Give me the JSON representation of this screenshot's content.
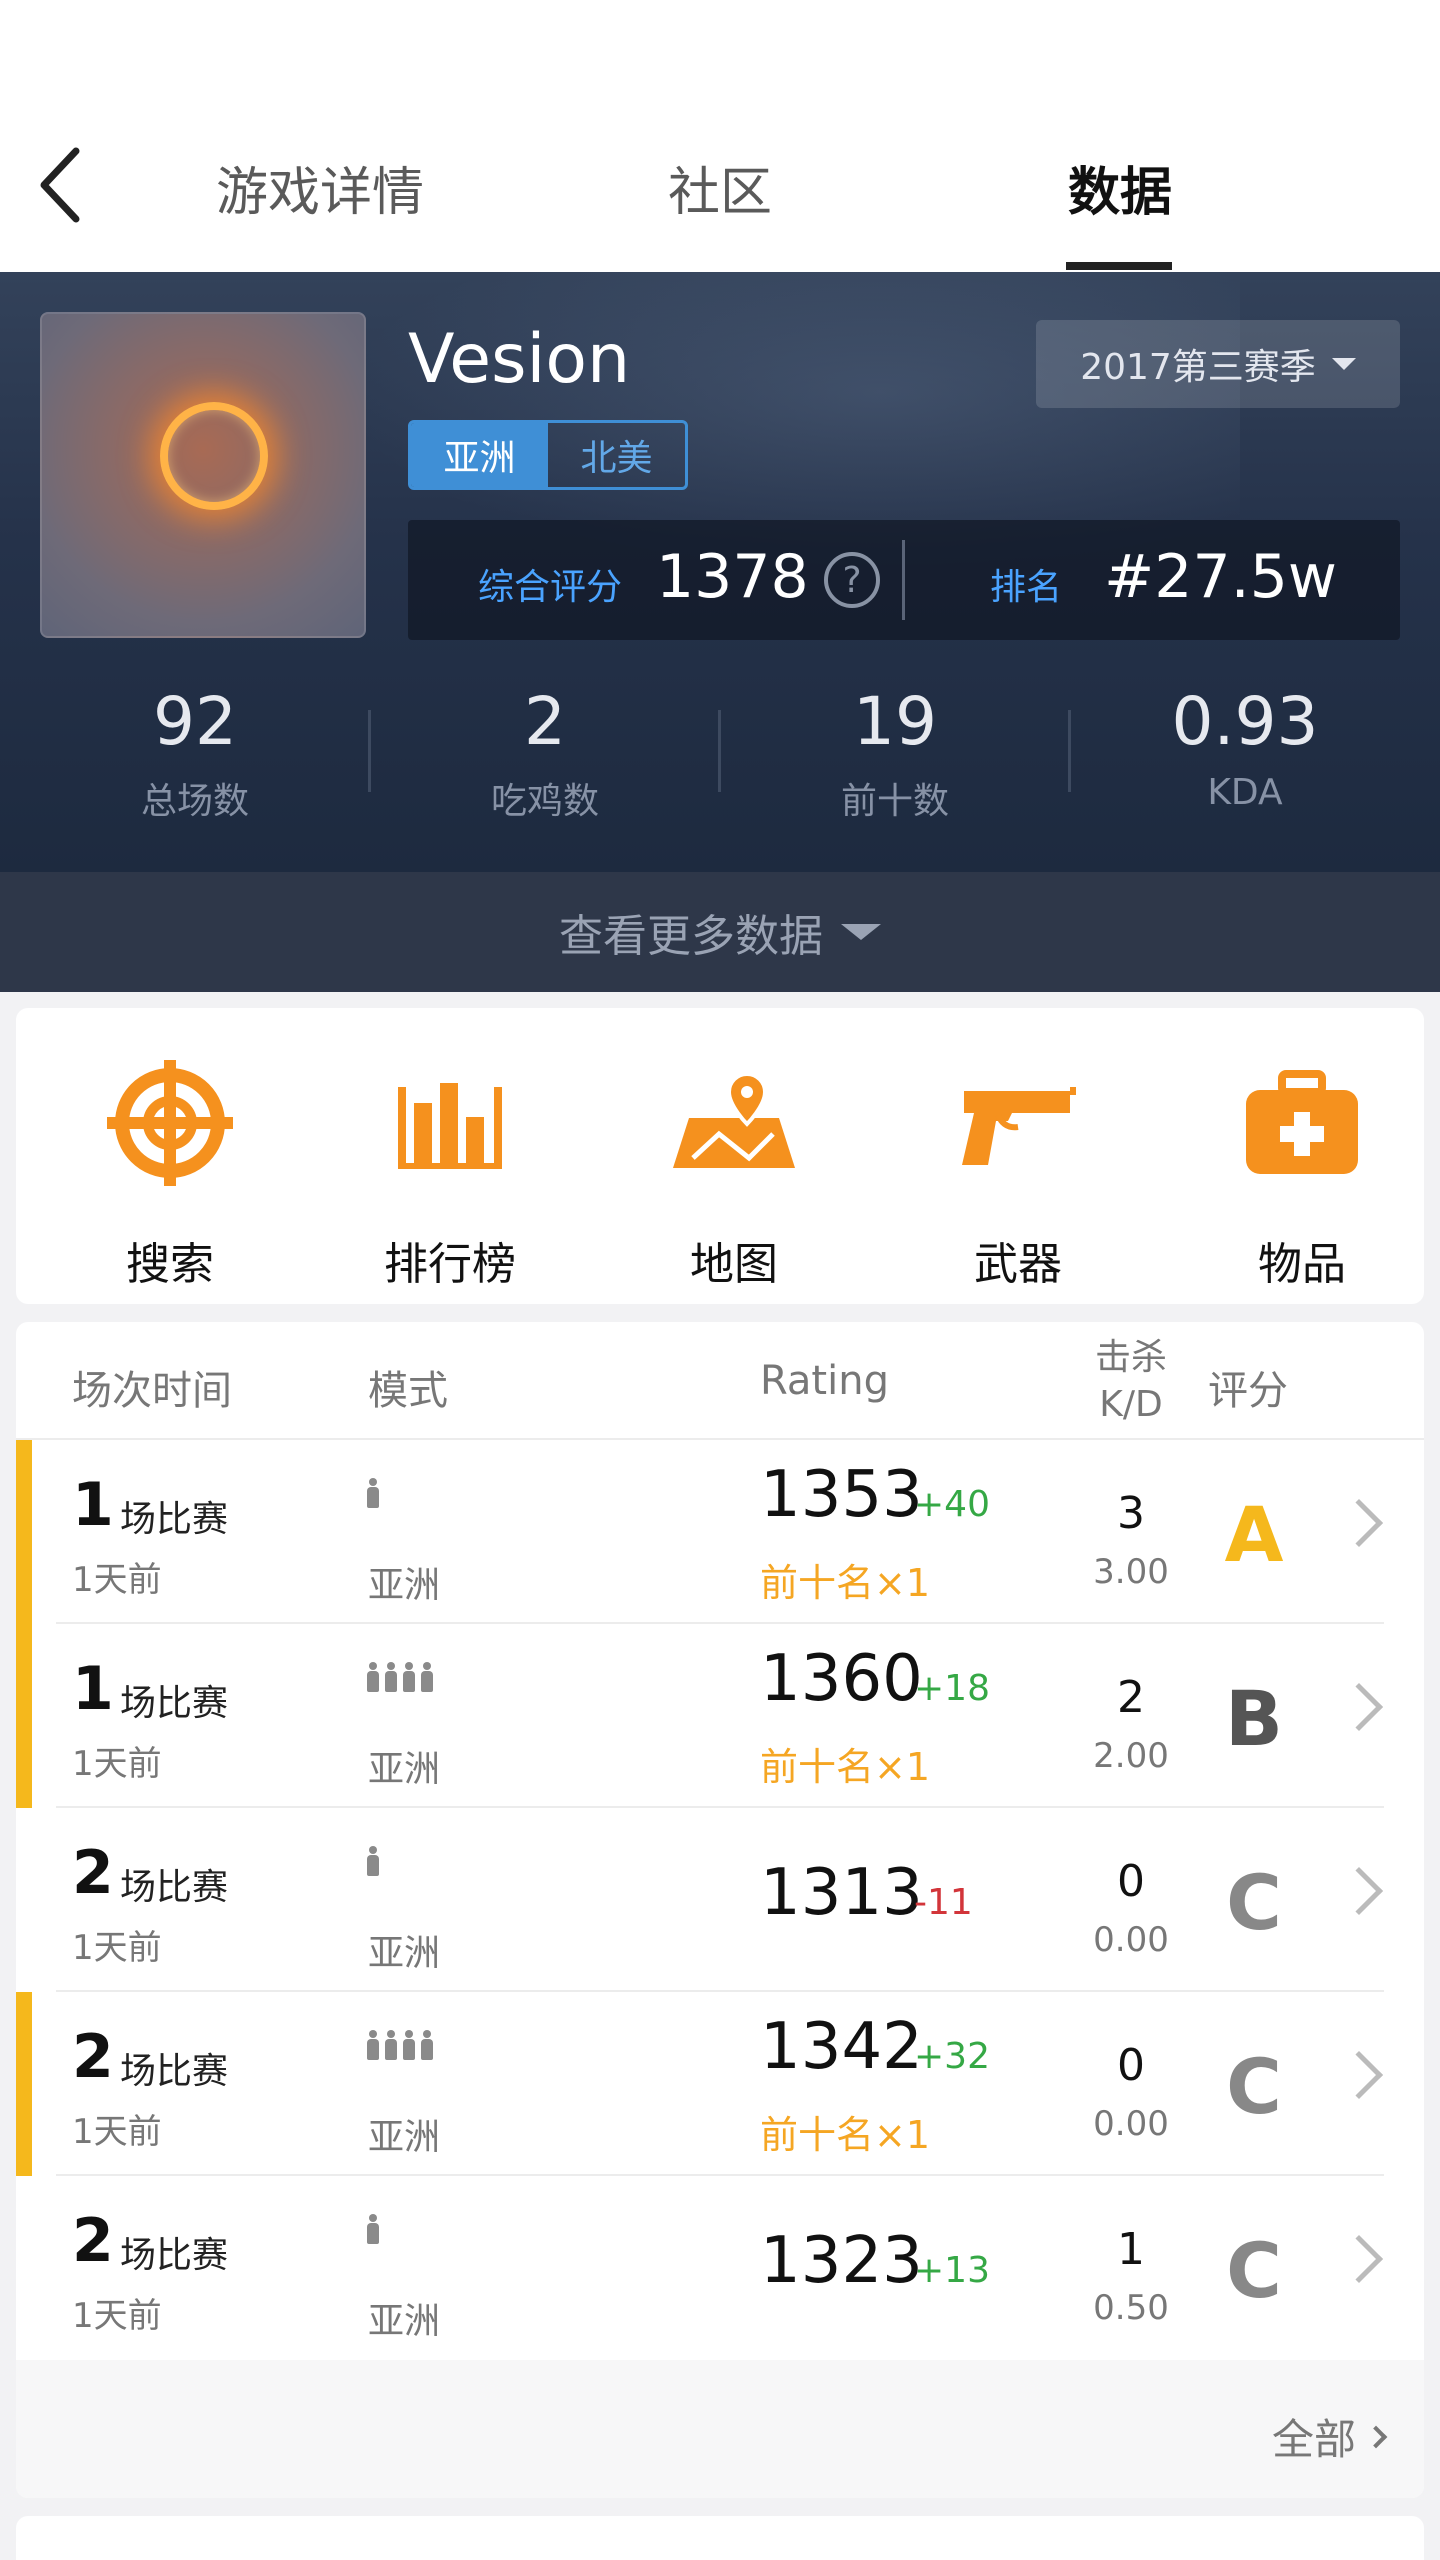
{
  "nav": {
    "tabs": [
      {
        "label": "游戏详情"
      },
      {
        "label": "社区"
      },
      {
        "label": "数据"
      }
    ],
    "active_tab": "数据"
  },
  "profile": {
    "username": "Vesion",
    "season": "2017第三赛季",
    "regions": [
      "亚洲",
      "北美"
    ],
    "selected_region": "亚洲",
    "score_label": "综合评分",
    "score": "1378",
    "rank_label": "排名",
    "rank": "#27.5w",
    "stats": [
      {
        "value": "92",
        "label": "总场数"
      },
      {
        "value": "2",
        "label": "吃鸡数"
      },
      {
        "value": "19",
        "label": "前十数"
      },
      {
        "value": "0.93",
        "label": "KDA"
      }
    ],
    "more_label": "查看更多数据"
  },
  "features": [
    {
      "label": "搜索",
      "icon": "crosshair-icon"
    },
    {
      "label": "排行榜",
      "icon": "leaderboard-icon"
    },
    {
      "label": "地图",
      "icon": "map-icon"
    },
    {
      "label": "武器",
      "icon": "pistol-icon"
    },
    {
      "label": "物品",
      "icon": "medkit-icon"
    }
  ],
  "matches": {
    "headers": {
      "time": "场次时间",
      "mode": "模式",
      "rating": "Rating",
      "kills_line1": "击杀",
      "kills_line2": "K/D",
      "grade": "评分"
    },
    "rows": [
      {
        "count": "1",
        "unit": "场比赛",
        "ago": "1天前",
        "squad": 1,
        "region": "亚洲",
        "rating": "1353",
        "delta": "+40",
        "top10": "前十名×1",
        "kills": "3",
        "kd": "3.00",
        "grade": "A"
      },
      {
        "count": "1",
        "unit": "场比赛",
        "ago": "1天前",
        "squad": 4,
        "region": "亚洲",
        "rating": "1360",
        "delta": "+18",
        "top10": "前十名×1",
        "kills": "2",
        "kd": "2.00",
        "grade": "B"
      },
      {
        "count": "2",
        "unit": "场比赛",
        "ago": "1天前",
        "squad": 1,
        "region": "亚洲",
        "rating": "1313",
        "delta": "-11",
        "top10": "",
        "kills": "0",
        "kd": "0.00",
        "grade": "C"
      },
      {
        "count": "2",
        "unit": "场比赛",
        "ago": "1天前",
        "squad": 4,
        "region": "亚洲",
        "rating": "1342",
        "delta": "+32",
        "top10": "前十名×1",
        "kills": "0",
        "kd": "0.00",
        "grade": "C"
      },
      {
        "count": "2",
        "unit": "场比赛",
        "ago": "1天前",
        "squad": 1,
        "region": "亚洲",
        "rating": "1323",
        "delta": "+13",
        "top10": "",
        "kills": "1",
        "kd": "0.50",
        "grade": "C"
      }
    ],
    "all_label": "全部"
  },
  "colors": {
    "accent_orange": "#f5911e",
    "highlight_yellow": "#f5b81c",
    "blue": "#3f8fd6",
    "positive": "#35a845",
    "negative": "#d2353a"
  }
}
